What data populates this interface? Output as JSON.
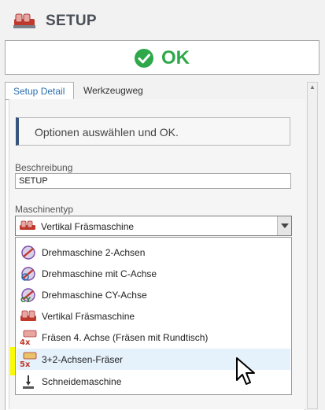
{
  "header": {
    "title": "SETUP",
    "logo_icon": "setup-machine-icon"
  },
  "ok": {
    "label": "OK",
    "icon": "checkmark-circle-icon",
    "color": "#2ea84a"
  },
  "tabs": [
    {
      "label": "Setup Detail",
      "active": true
    },
    {
      "label": "Werkzeugweg",
      "active": false
    }
  ],
  "info": {
    "text": "Optionen auswählen und OK."
  },
  "beschreibung": {
    "label": "Beschreibung",
    "value": "SETUP"
  },
  "maschinentyp": {
    "label": "Maschinentyp",
    "selected": "Vertikal Fräsmaschine",
    "options": [
      {
        "label": "Drehmaschine 2-Achsen",
        "icon": "lathe-2-axis-icon"
      },
      {
        "label": "Drehmaschine mit C-Achse",
        "icon": "lathe-c-axis-icon"
      },
      {
        "label": "Drehmaschine CY-Achse",
        "icon": "lathe-cy-axis-icon"
      },
      {
        "label": "Vertikal Fräsmaschine",
        "icon": "vertical-mill-icon"
      },
      {
        "label": "Fräsen 4. Achse (Fräsen mit Rundtisch)",
        "icon": "mill-4-axis-icon",
        "badge": "4x"
      },
      {
        "label": "3+2-Achsen-Fräser",
        "icon": "mill-5-axis-icon",
        "badge": "5x",
        "hovered": true
      },
      {
        "label": "Schneidemaschine",
        "icon": "cutting-machine-icon"
      }
    ]
  },
  "colors": {
    "highlight": "#fafa00",
    "accent_tab": "#2a6fb0",
    "info_border": "#39557d"
  }
}
